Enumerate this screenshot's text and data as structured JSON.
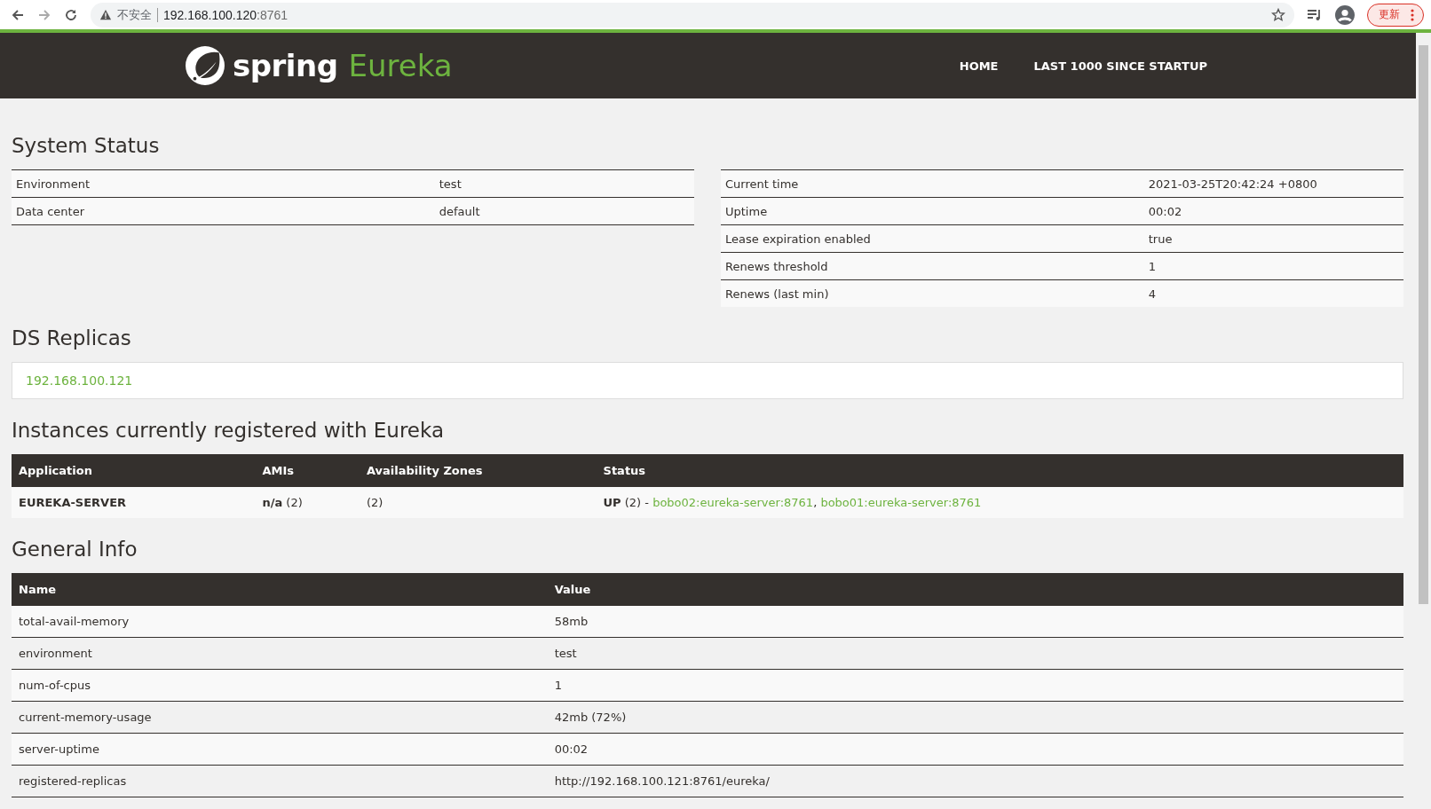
{
  "browser": {
    "security_label": "不安全",
    "url_host": "192.168.100.120",
    "url_port": ":8761",
    "update_button": "更新"
  },
  "header": {
    "logo_word": "spring",
    "logo_product": "Eureka",
    "nav": [
      {
        "label": "HOME"
      },
      {
        "label": "LAST 1000 SINCE STARTUP"
      }
    ]
  },
  "system_status": {
    "title": "System Status",
    "left": [
      {
        "name": "Environment",
        "value": "test"
      },
      {
        "name": "Data center",
        "value": "default"
      }
    ],
    "right": [
      {
        "name": "Current time",
        "value": "2021-03-25T20:42:24 +0800"
      },
      {
        "name": "Uptime",
        "value": "00:02"
      },
      {
        "name": "Lease expiration enabled",
        "value": "true"
      },
      {
        "name": "Renews threshold",
        "value": "1"
      },
      {
        "name": "Renews (last min)",
        "value": "4"
      }
    ]
  },
  "ds_replicas": {
    "title": "DS Replicas",
    "replicas": [
      "192.168.100.121"
    ]
  },
  "instances": {
    "title": "Instances currently registered with Eureka",
    "columns": [
      "Application",
      "AMIs",
      "Availability Zones",
      "Status"
    ],
    "rows": [
      {
        "application": "EUREKA-SERVER",
        "amis": "**n/a** (2)",
        "zones": "(2)",
        "status": "**UP** (2) -",
        "instances": [
          "bobo02:eureka-server:8761",
          "bobo01:eureka-server:8761"
        ],
        "separator": ","
      }
    ]
  },
  "general_info": {
    "title": "General Info",
    "columns": [
      "Name",
      "Value"
    ],
    "rows": [
      {
        "name": "total-avail-memory",
        "value": "58mb"
      },
      {
        "name": "environment",
        "value": "test"
      },
      {
        "name": "num-of-cpus",
        "value": "1"
      },
      {
        "name": "current-memory-usage",
        "value": "42mb (72%)"
      },
      {
        "name": "server-uptime",
        "value": "00:02"
      },
      {
        "name": "registered-replicas",
        "value": "http://192.168.100.121:8761/eureka/"
      }
    ]
  }
}
